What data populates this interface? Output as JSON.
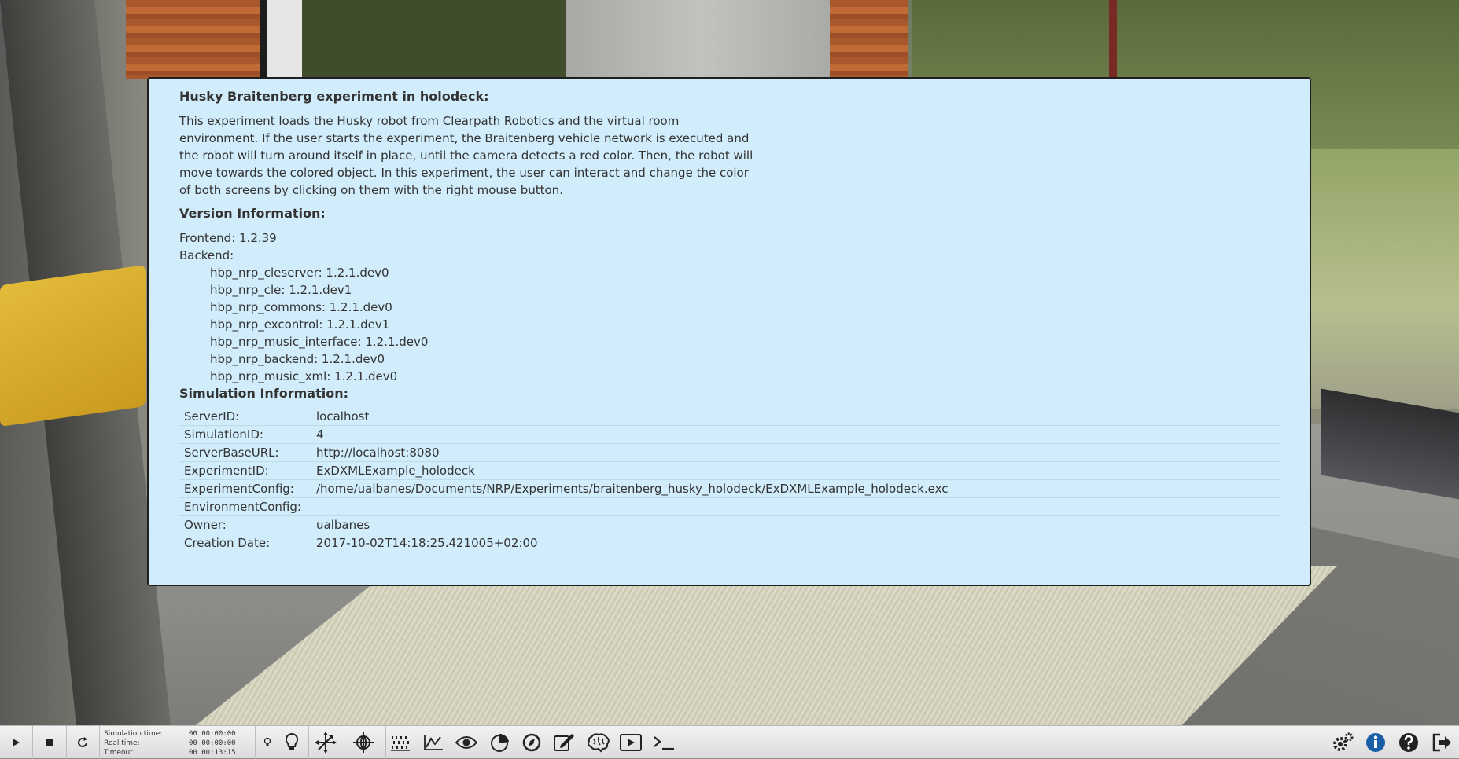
{
  "dialog": {
    "title": "Husky Braitenberg experiment in holodeck:",
    "description": "This experiment loads the Husky robot from Clearpath Robotics and the virtual room environment. If the user starts the experiment, the Braitenberg vehicle network is executed and the robot will turn around itself in place, until the camera detects a red color. Then, the robot will move towards the colored object. In this experiment, the user can interact and change the color of both screens by clicking on them with the right mouse button.",
    "version_heading": "Version Information:",
    "frontend": "Frontend: 1.2.39",
    "backend_label": "Backend:",
    "backend_items": [
      "hbp_nrp_cleserver: 1.2.1.dev0",
      "hbp_nrp_cle: 1.2.1.dev1",
      "hbp_nrp_commons: 1.2.1.dev0",
      "hbp_nrp_excontrol: 1.2.1.dev1",
      "hbp_nrp_music_interface: 1.2.1.dev0",
      "hbp_nrp_backend: 1.2.1.dev0",
      "hbp_nrp_music_xml: 1.2.1.dev0"
    ],
    "sim_heading": "Simulation Information:",
    "sim_rows": [
      {
        "key": "ServerID:",
        "value": "localhost"
      },
      {
        "key": "SimulationID:",
        "value": "4"
      },
      {
        "key": "ServerBaseURL:",
        "value": "http://localhost:8080"
      },
      {
        "key": "ExperimentID:",
        "value": "ExDXMLExample_holodeck"
      },
      {
        "key": "ExperimentConfig:",
        "value": "/home/ualbanes/Documents/NRP/Experiments/braitenberg_husky_holodeck/ExDXMLExample_holodeck.exc"
      },
      {
        "key": "EnvironmentConfig:",
        "value": ""
      },
      {
        "key": "Owner:",
        "value": "ualbanes"
      },
      {
        "key": "Creation Date:",
        "value": "2017-10-02T14:18:25.421005+02:00"
      }
    ]
  },
  "toolbar": {
    "timer": {
      "sim_label": "Simulation time:",
      "sim_value": "00 00:00:00",
      "real_label": "Real time:",
      "real_value": "00 00:00:00",
      "timeout_label": "Timeout:",
      "timeout_value": "00 00:13:15"
    },
    "left_buttons": [
      "play-icon",
      "stop-icon",
      "reset-icon"
    ],
    "tool_icons": [
      "light-small-icon",
      "light-bulb-icon",
      "translate-icon",
      "rotate-icon",
      "spike-raster-icon",
      "line-chart-icon",
      "eye-icon",
      "robot-view-icon",
      "navigation-icon",
      "editor-icon",
      "brain-icon",
      "video-icon",
      "terminal-icon"
    ],
    "right_icons": [
      "settings-icon",
      "info-icon",
      "help-icon",
      "exit-icon"
    ]
  }
}
